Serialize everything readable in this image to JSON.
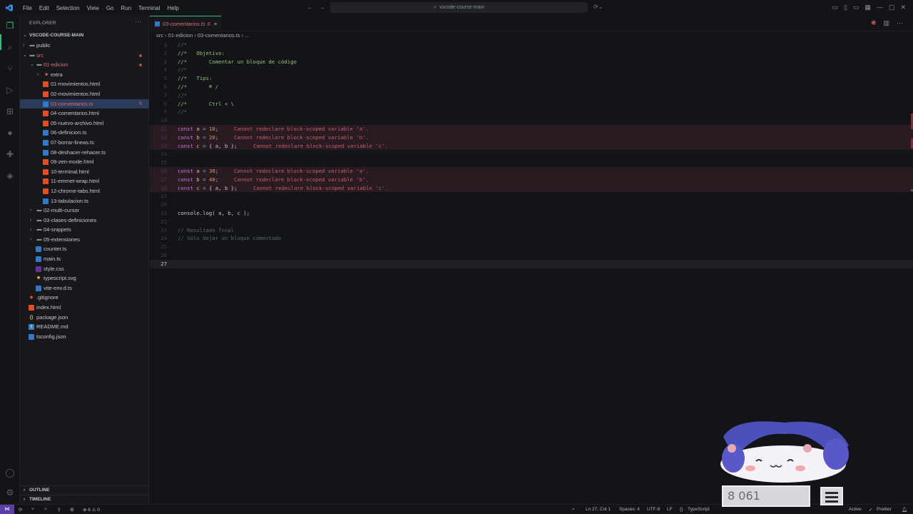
{
  "titlebar": {
    "menu": [
      "File",
      "Edit",
      "Selection",
      "View",
      "Go",
      "Run",
      "Terminal",
      "Help"
    ],
    "search_text": "vscode-course-main"
  },
  "sidebar": {
    "header": "EXPLORER",
    "root": "VSCODE-COURSE-MAIN",
    "items": [
      {
        "label": "public",
        "type": "folder",
        "depth": 1,
        "chev": "›"
      },
      {
        "label": "src",
        "type": "folder",
        "depth": 1,
        "chev": "⌄",
        "status": "error",
        "dot": true
      },
      {
        "label": "01-edicion",
        "type": "folder",
        "depth": 2,
        "chev": "⌄",
        "status": "error",
        "dot": true
      },
      {
        "label": "extra",
        "type": "folder-red",
        "depth": 3,
        "chev": "›"
      },
      {
        "label": "01-movimientos.html",
        "type": "html",
        "depth": 3
      },
      {
        "label": "02-movimientos.html",
        "type": "html",
        "depth": 3
      },
      {
        "label": "03-comentarios.ts",
        "type": "ts",
        "depth": 3,
        "status": "error",
        "selected": true,
        "count": "6"
      },
      {
        "label": "04-comentarios.html",
        "type": "html",
        "depth": 3
      },
      {
        "label": "05-nuevo-archivo.html",
        "type": "html",
        "depth": 3
      },
      {
        "label": "06-definicion.ts",
        "type": "ts",
        "depth": 3
      },
      {
        "label": "07-borrar-lineas.ts",
        "type": "ts",
        "depth": 3
      },
      {
        "label": "08-deshacer-rehacer.ts",
        "type": "ts",
        "depth": 3
      },
      {
        "label": "09-zen-mode.html",
        "type": "html",
        "depth": 3
      },
      {
        "label": "10-terminal.html",
        "type": "html",
        "depth": 3
      },
      {
        "label": "11-emmet-wrap.html",
        "type": "html",
        "depth": 3
      },
      {
        "label": "12-chrome-tabs.html",
        "type": "html",
        "depth": 3
      },
      {
        "label": "13-tabulacion.ts",
        "type": "ts",
        "depth": 3
      },
      {
        "label": "02-multi-cursor",
        "type": "folder",
        "depth": 2,
        "chev": "›"
      },
      {
        "label": "03-clases-definiciones",
        "type": "folder",
        "depth": 2,
        "chev": "›"
      },
      {
        "label": "04-snippets",
        "type": "folder",
        "depth": 2,
        "chev": "›"
      },
      {
        "label": "05-extensiones",
        "type": "folder",
        "depth": 2,
        "chev": "›"
      },
      {
        "label": "counter.ts",
        "type": "ts",
        "depth": 2
      },
      {
        "label": "main.ts",
        "type": "ts",
        "depth": 2
      },
      {
        "label": "style.css",
        "type": "css",
        "depth": 2
      },
      {
        "label": "typescript.svg",
        "type": "svg",
        "depth": 2
      },
      {
        "label": "vite-env.d.ts",
        "type": "ts",
        "depth": 2
      },
      {
        "label": ".gitignore",
        "type": "git",
        "depth": 1
      },
      {
        "label": "index.html",
        "type": "html",
        "depth": 1
      },
      {
        "label": "package.json",
        "type": "json",
        "depth": 1
      },
      {
        "label": "README.md",
        "type": "md",
        "depth": 1
      },
      {
        "label": "tsconfig.json",
        "type": "tsjson",
        "depth": 1
      }
    ],
    "outline": "OUTLINE",
    "timeline": "TIMELINE"
  },
  "editor": {
    "tab": {
      "label": "03-comentarios.ts",
      "count": "6",
      "close": "×"
    },
    "breadcrumbs": "src › 01-edicion › 03-comentarios.ts › ...",
    "lines": [
      {
        "n": "1",
        "t": "//*",
        "k": "cm"
      },
      {
        "n": "2",
        "t": "//*   Objetivo:",
        "k": "cmg"
      },
      {
        "n": "3",
        "t": "//*       Comentar un bloque de código",
        "k": "cmg"
      },
      {
        "n": "4",
        "t": "//*",
        "k": "cm"
      },
      {
        "n": "5",
        "t": "//*   Tips:",
        "k": "cmg"
      },
      {
        "n": "6",
        "t": "//*       ⌘ /",
        "k": "cmg"
      },
      {
        "n": "7",
        "t": "//*",
        "k": "cm"
      },
      {
        "n": "8",
        "t": "//*       Ctrl + \\",
        "k": "cmg"
      },
      {
        "n": "9",
        "t": "//*",
        "k": "cm"
      },
      {
        "n": "10",
        "t": "",
        "k": "pl"
      },
      {
        "n": "11",
        "t": "const a = 10;",
        "k": "code",
        "err": "Cannot redeclare block-scoped variable 'a'."
      },
      {
        "n": "12",
        "t": "const b = 20;",
        "k": "code",
        "err": "Cannot redeclare block-scoped variable 'b'."
      },
      {
        "n": "13",
        "t": "const c = { a, b };",
        "k": "code",
        "err": "Cannot redeclare block-scoped variable 'c'."
      },
      {
        "n": "14",
        "t": "",
        "k": "pl"
      },
      {
        "n": "15",
        "t": "",
        "k": "pl"
      },
      {
        "n": "16",
        "t": "const a = 30;",
        "k": "code",
        "err": "Cannot redeclare block-scoped variable 'a'."
      },
      {
        "n": "17",
        "t": "const b = 40;",
        "k": "code",
        "err": "Cannot redeclare block-scoped variable 'b'."
      },
      {
        "n": "18",
        "t": "const c = { a, b };",
        "k": "code",
        "err": "Cannot redeclare block-scoped variable 'c'."
      },
      {
        "n": "19",
        "t": "",
        "k": "pl"
      },
      {
        "n": "20",
        "t": "",
        "k": "pl"
      },
      {
        "n": "21",
        "t": "console.log( a, b, c );",
        "k": "pl"
      },
      {
        "n": "22",
        "t": "",
        "k": "pl"
      },
      {
        "n": "23",
        "t": "// Resultado final",
        "k": "cm"
      },
      {
        "n": "24",
        "t": "// Sólo dejar un bloque comentado",
        "k": "cm"
      },
      {
        "n": "25",
        "t": "",
        "k": "pl"
      },
      {
        "n": "26",
        "t": "",
        "k": "pl"
      },
      {
        "n": "27",
        "t": "",
        "k": "pl",
        "current": true
      }
    ]
  },
  "statusbar": {
    "problems": "⊗ 6 ⚠ 0",
    "position": "Ln 27, Col 1",
    "spaces": "Spaces: 4",
    "encoding": "UTF-8",
    "eol": "LF",
    "language": "TypeScript",
    "active": "Active",
    "prettier": "Prettier"
  },
  "overlay": {
    "count": "8 061"
  }
}
